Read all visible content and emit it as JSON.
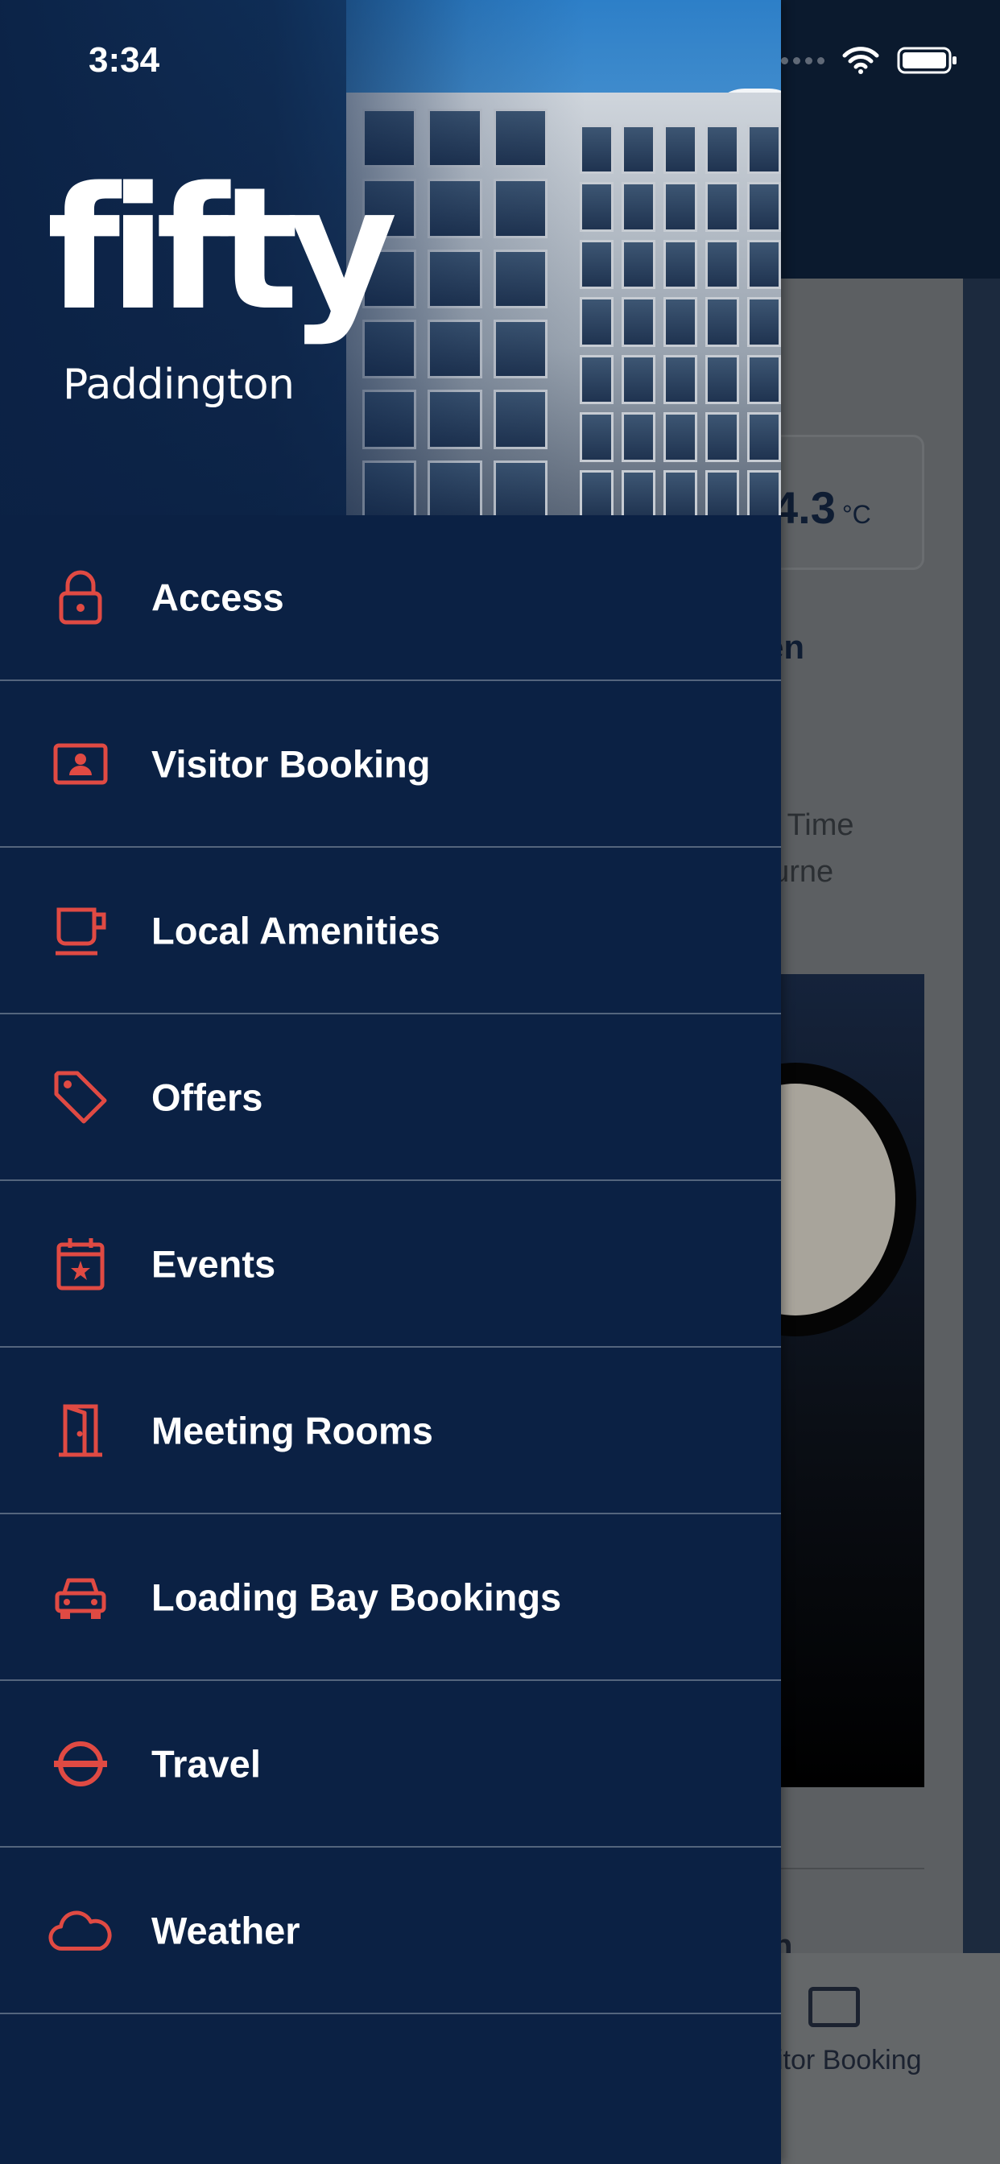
{
  "status_bar": {
    "time": "3:34"
  },
  "brand": {
    "logo": "fifty",
    "location": "Paddington"
  },
  "menu": {
    "items": [
      {
        "label": "Access",
        "icon": "lock-icon"
      },
      {
        "label": "Visitor Booking",
        "icon": "id-card-icon"
      },
      {
        "label": "Local Amenities",
        "icon": "coffee-cup-icon"
      },
      {
        "label": "Offers",
        "icon": "tag-icon"
      },
      {
        "label": "Events",
        "icon": "calendar-star-icon"
      },
      {
        "label": "Meeting Rooms",
        "icon": "door-icon"
      },
      {
        "label": "Loading Bay Bookings",
        "icon": "car-icon"
      },
      {
        "label": "Travel",
        "icon": "underground-roundel-icon"
      },
      {
        "label": "Weather",
        "icon": "cloud-icon"
      }
    ]
  },
  "background_screen": {
    "temperature": "4.3",
    "temperature_unit": "°C",
    "heading_fragment": "en",
    "text_line_1": "al Time",
    "text_line_2": "ourne",
    "section_fragment": "n",
    "tab_label": "itor Booking"
  },
  "colors": {
    "drawer_bg": "#0b2144",
    "accent": "#e04a43",
    "text": "#ffffff",
    "divider": "#54657d"
  }
}
